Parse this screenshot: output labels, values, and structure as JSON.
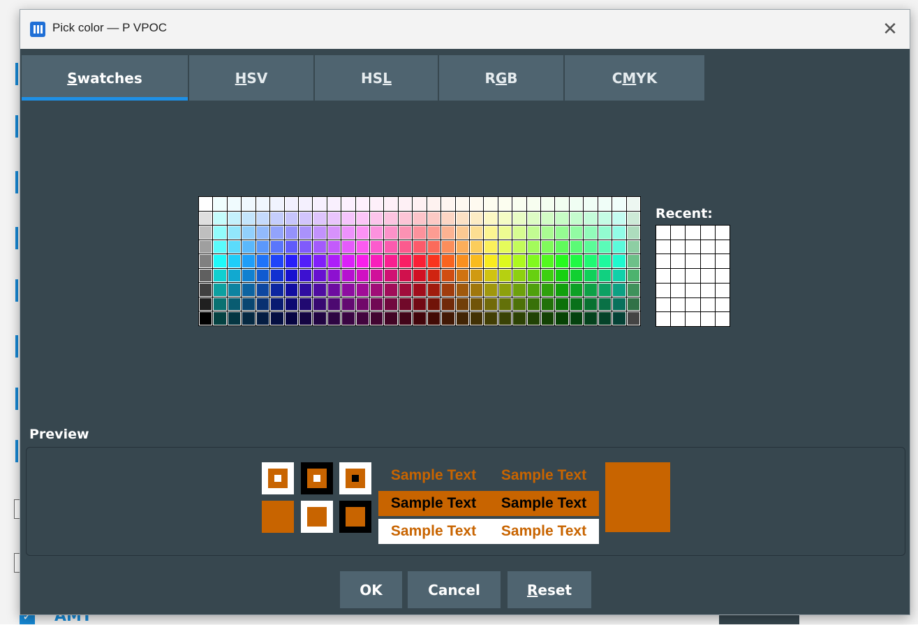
{
  "window": {
    "title": "Pick color — P VPOC",
    "close_glyph": "✕"
  },
  "tabs": [
    {
      "pre": "",
      "mnemonic": "S",
      "post": "watches",
      "active": true
    },
    {
      "pre": "",
      "mnemonic": "H",
      "post": "SV",
      "active": false
    },
    {
      "pre": "HS",
      "mnemonic": "L",
      "post": "",
      "active": false
    },
    {
      "pre": "R",
      "mnemonic": "G",
      "post": "B",
      "active": false
    },
    {
      "pre": "C",
      "mnemonic": "M",
      "post": "YK",
      "active": false
    }
  ],
  "recent": {
    "label": "Recent:"
  },
  "preview": {
    "label": "Preview",
    "sample_text": "Sample Text",
    "color": "#c86400"
  },
  "buttons": {
    "ok": {
      "pre": "OK",
      "mnemonic": "",
      "post": ""
    },
    "cancel": {
      "pre": "Cancel",
      "mnemonic": "",
      "post": ""
    },
    "reset": {
      "pre": "",
      "mnemonic": "R",
      "post": "eset"
    }
  },
  "background_app": {
    "label": "AMT",
    "check_glyph": "✓"
  },
  "colors": {
    "dialog_bg": "#37474f",
    "tab_bg": "#4f6470",
    "accent": "#1e90e6",
    "preview_color": "#c86400"
  }
}
